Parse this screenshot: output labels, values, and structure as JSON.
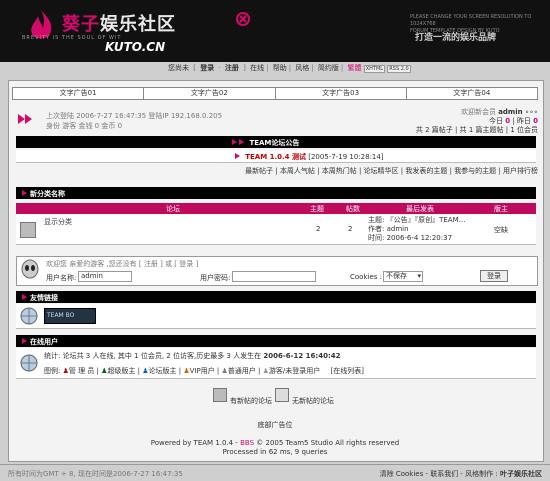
{
  "header": {
    "logo_title_a": "葵子",
    "logo_title_b": "娱乐社区",
    "logo_tag": "BREVITY IS THE SOUL OF WIT",
    "logo_domain": "KUTO.CN",
    "note_line1": "PLEASE CHANGE YOUR SCREEN RESOLUTION TO 1024X768",
    "note_line2": "FORUM TEMPLATE DESIGN BY KUTO",
    "slogan": "打造一流的娱乐品牌"
  },
  "nav": {
    "greeting": "您尚未",
    "login": "登录",
    "register": "注册",
    "items": [
      "在线",
      "帮助",
      "风格",
      "简约版"
    ],
    "hot": "繁體",
    "badge1": "XHTML",
    "badge2": "RSS 2.0"
  },
  "ads": [
    "文字广告01",
    "文字广告02",
    "文字广告03",
    "文字广告04"
  ],
  "info": {
    "last_visit": "上次登陆 2006-7-27 16:47:35 登陆IP 192.168.0.205",
    "status": "身份 游客 金钱 0 金币 0",
    "welcome": "欢迎新会员",
    "new_member": "admin",
    "today": "今日",
    "today_num": "0",
    "yesterday": "昨日",
    "yesterday_num": "0",
    "stats": "共 2 篇帖子 | 共 1 篇主题帖 | 1 位会员"
  },
  "notice": {
    "bar_title": "TEAM论坛公告",
    "item_title": "TEAM 1.0.4 测试",
    "item_date": "[2005-7-19 10:28:14]",
    "links": [
      "最新帖子",
      "本周人气帖",
      "本周热门帖",
      "论坛精华区",
      "我发表的主题",
      "我参与的主题",
      "用户排行榜"
    ]
  },
  "category": {
    "name": "新分类名称",
    "col_forum": "论坛",
    "col_topics": "主题",
    "col_posts": "帖数",
    "col_last": "最后发表",
    "col_mod": "版主",
    "forum_name": "显示分类",
    "topics": "2",
    "posts": "2",
    "last_title": "主题: 『公告』『原创』TEAM…",
    "last_author": "作者: admin",
    "last_time": "时间: 2006-6-4 12:20:37",
    "moderator": "空缺"
  },
  "login": {
    "hint": "欢迎您 亲爱的游客 ,您还没有 [ 注册 ] 或 [ 登录 ]",
    "user_label": "用户名称:",
    "user_value": "admin",
    "pass_label": "用户密码:",
    "cookies_label": "Cookies :",
    "cookies_option": "不保存",
    "submit": "登录"
  },
  "friend": {
    "title": "友情链接",
    "link_text": "TEAM BO"
  },
  "online": {
    "title": "在线用户",
    "summary": "统计: 论坛共 3 人在线, 其中 1 位会员, 2 位访客,历史最多 3 人发生在",
    "peak_time": "2006-6-12 16:40:42",
    "legend_label": "图例:",
    "legend": [
      "管 理 员",
      "超级版主",
      "论坛版主",
      "VIP用户",
      "普通用户",
      "游客/未登录用户"
    ],
    "list_link": "[在线列表]"
  },
  "icons_legend": [
    "有新帖的论坛",
    "无新帖的论坛"
  ],
  "bottom_ad": "底部广告位",
  "powered": "Powered by TEAM 1.0.4 - ",
  "powered_mid": "BBS",
  "powered_tail": "© 2005 Team5 Studio All rights reserved",
  "processed": "Processed in 62 ms, 9 queries",
  "footer": {
    "time": "所有时间为GMT + 8, 现在时间是2006-7-27 16:47:35",
    "links": "清除 Cookies - 联系我们 - 风格制作 :",
    "brand": "叶子娱乐社区"
  },
  "colors": {
    "accent": "#d40a6b",
    "header_bg": "#111111",
    "bar_bg": "#000000"
  }
}
